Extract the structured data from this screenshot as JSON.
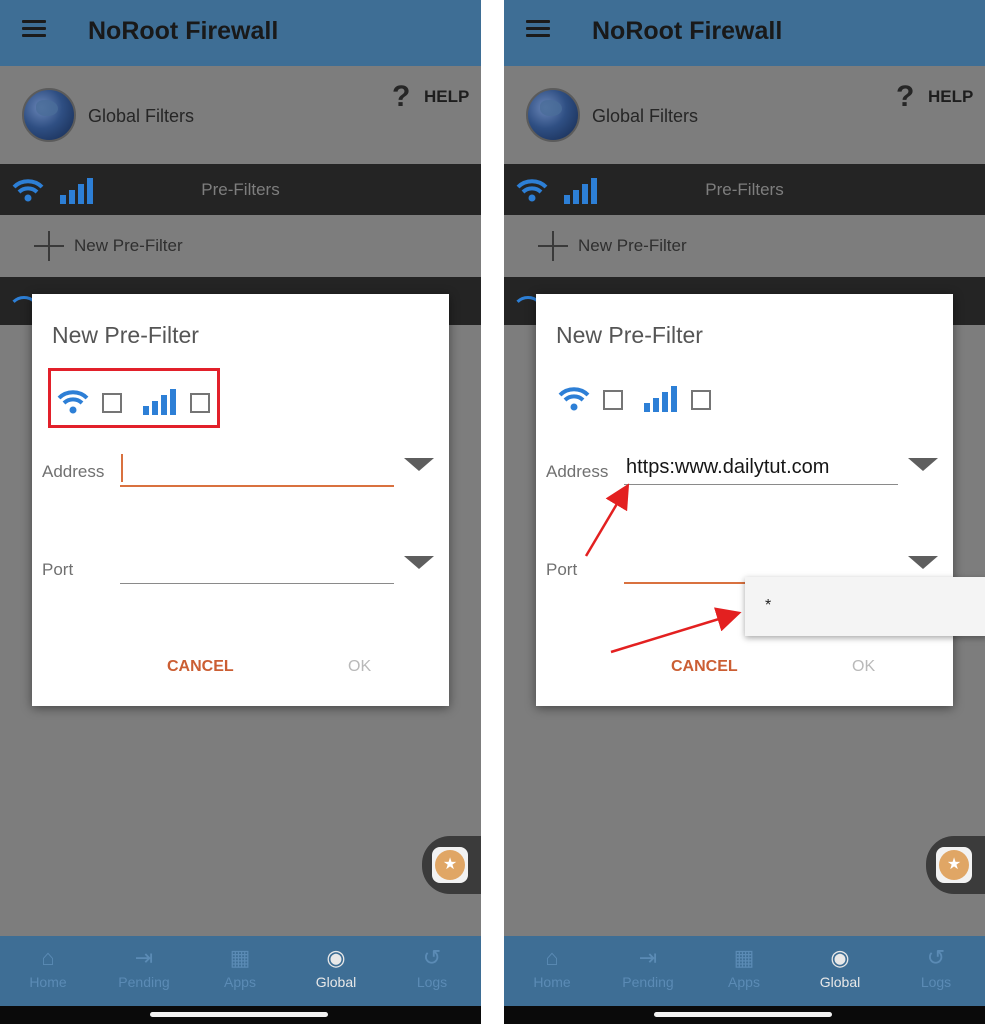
{
  "app": {
    "title": "NoRoot Firewall"
  },
  "header": {
    "global_filters": "Global Filters",
    "help": "HELP",
    "help_glyph": "?"
  },
  "prefilters_bar": {
    "label": "Pre-Filters"
  },
  "new_prefilter_row": {
    "label": "New Pre-Filter"
  },
  "dialog": {
    "title": "New Pre-Filter",
    "address_label": "Address",
    "port_label": "Port",
    "cancel": "CANCEL",
    "ok": "OK"
  },
  "left_screen": {
    "address_value": "",
    "port_value": "",
    "wifi_checked": false,
    "mobile_checked": false
  },
  "right_screen": {
    "address_value": "https:www.dailytut.com",
    "port_value": "",
    "suggestion": "*",
    "wifi_checked": false,
    "mobile_checked": false
  },
  "nav": {
    "items": [
      {
        "label": "Home",
        "icon": "home-icon"
      },
      {
        "label": "Pending",
        "icon": "pending-icon"
      },
      {
        "label": "Apps",
        "icon": "apps-icon"
      },
      {
        "label": "Global",
        "icon": "globe-icon"
      },
      {
        "label": "Logs",
        "icon": "logs-icon"
      }
    ],
    "active": "Global"
  },
  "colors": {
    "appbar": "#3e6e95",
    "accent": "#cb5e33",
    "highlight": "#e2202a",
    "wifi_blue": "#2d7fd6"
  }
}
